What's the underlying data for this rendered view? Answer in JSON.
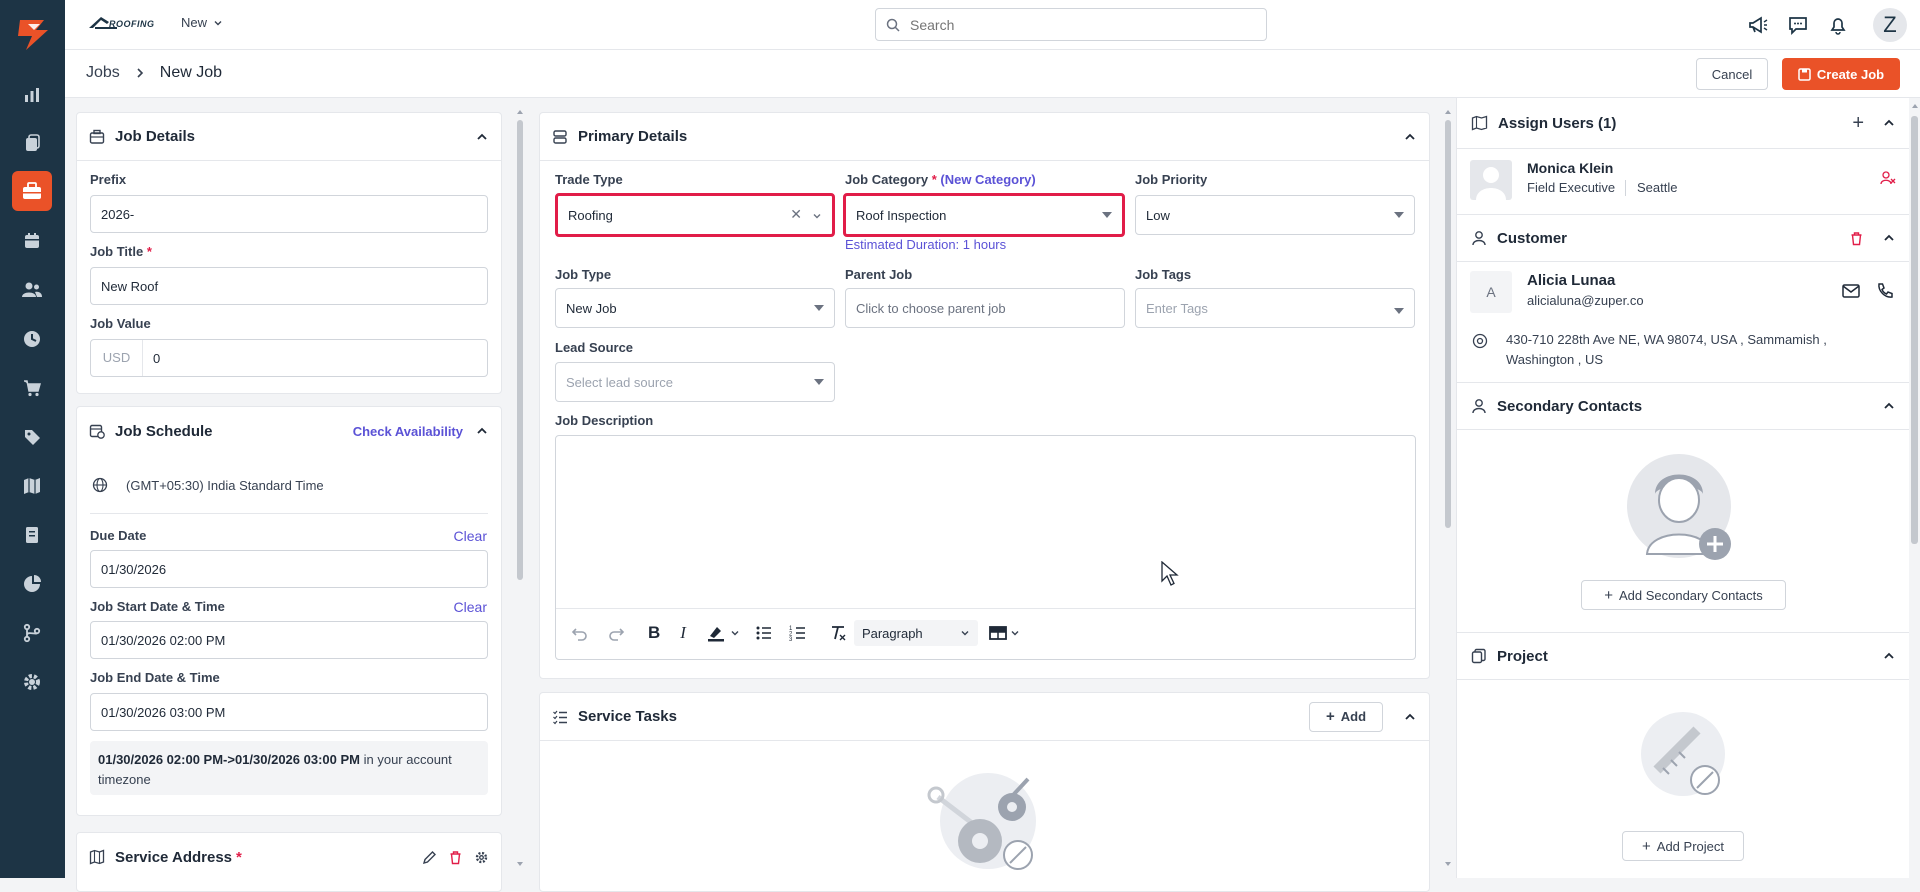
{
  "app": {
    "brand": "ROOFING",
    "new_menu": "New"
  },
  "search": {
    "placeholder": "Search"
  },
  "user": {
    "avatar_letter": "Z"
  },
  "breadcrumb": {
    "root": "Jobs",
    "current": "New Job"
  },
  "actions": {
    "cancel": "Cancel",
    "create": "Create Job"
  },
  "job_details": {
    "title": "Job Details",
    "prefix_label": "Prefix",
    "prefix_value": "2026-",
    "job_title_label": "Job Title",
    "job_title_value": "New Roof",
    "job_value_label": "Job Value",
    "currency": "USD",
    "job_value": "0"
  },
  "job_schedule": {
    "title": "Job Schedule",
    "check_availability": "Check Availability",
    "timezone": "(GMT+05:30) India Standard Time",
    "due_date_label": "Due Date",
    "due_date_value": "01/30/2026",
    "clear": "Clear",
    "start_label": "Job Start Date & Time",
    "start_value": "01/30/2026 02:00 PM",
    "end_label": "Job End Date & Time",
    "end_value": "01/30/2026 03:00 PM",
    "summary_bold": "01/30/2026 02:00 PM->01/30/2026 03:00 PM",
    "summary_rest": " in your account timezone"
  },
  "service_address": {
    "title": "Service Address"
  },
  "primary_details": {
    "title": "Primary Details",
    "trade_type_label": "Trade Type",
    "trade_type_value": "Roofing",
    "job_category_label": "Job Category",
    "new_category": "(New Category)",
    "job_category_value": "Roof Inspection",
    "estimated_duration": "Estimated Duration: 1 hours",
    "job_priority_label": "Job Priority",
    "job_priority_value": "Low",
    "job_type_label": "Job Type",
    "job_type_value": "New Job",
    "parent_job_label": "Parent Job",
    "parent_job_placeholder": "Click to choose parent job",
    "job_tags_label": "Job Tags",
    "job_tags_placeholder": "Enter Tags",
    "lead_source_label": "Lead Source",
    "lead_source_placeholder": "Select lead source",
    "description_label": "Job Description",
    "paragraph_select": "Paragraph"
  },
  "service_tasks": {
    "title": "Service Tasks",
    "add": "Add"
  },
  "assign_users": {
    "title": "Assign Users (1)",
    "user_name": "Monica Klein",
    "user_role": "Field Executive",
    "user_location": "Seattle"
  },
  "customer": {
    "title": "Customer",
    "avatar": "A",
    "name": "Alicia Lunaa",
    "email": "alicialuna@zuper.co",
    "address_line1": "430-710 228th Ave NE, WA 98074, USA , Sammamish ,",
    "address_line2": "Washington , US"
  },
  "secondary_contacts": {
    "title": "Secondary Contacts",
    "add": "Add Secondary Contacts"
  },
  "project": {
    "title": "Project",
    "add": "Add Project"
  },
  "colors": {
    "rail": "#1d3445",
    "accent": "#ea5228",
    "link": "#5b52d6",
    "highlight": "#e11d48"
  }
}
